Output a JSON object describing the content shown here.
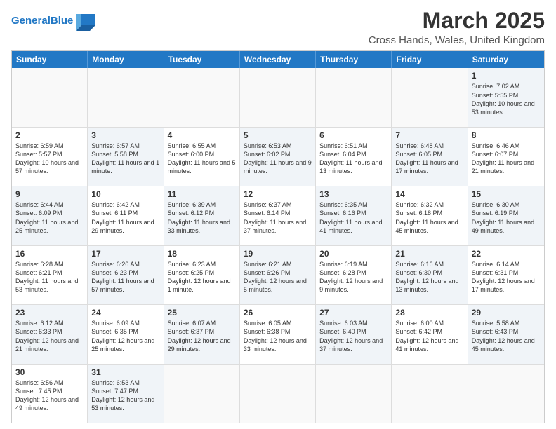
{
  "header": {
    "logo_general": "General",
    "logo_blue": "Blue",
    "month_title": "March 2025",
    "location": "Cross Hands, Wales, United Kingdom"
  },
  "day_headers": [
    "Sunday",
    "Monday",
    "Tuesday",
    "Wednesday",
    "Thursday",
    "Friday",
    "Saturday"
  ],
  "weeks": [
    [
      {
        "day": "",
        "text": "",
        "empty": true
      },
      {
        "day": "",
        "text": "",
        "empty": true
      },
      {
        "day": "",
        "text": "",
        "empty": true
      },
      {
        "day": "",
        "text": "",
        "empty": true
      },
      {
        "day": "",
        "text": "",
        "empty": true
      },
      {
        "day": "",
        "text": "",
        "empty": true
      },
      {
        "day": "1",
        "text": "Sunrise: 7:02 AM\nSunset: 5:55 PM\nDaylight: 10 hours\nand 53 minutes.",
        "shaded": true
      }
    ],
    [
      {
        "day": "2",
        "text": "Sunrise: 6:59 AM\nSunset: 5:57 PM\nDaylight: 10 hours\nand 57 minutes."
      },
      {
        "day": "3",
        "text": "Sunrise: 6:57 AM\nSunset: 5:58 PM\nDaylight: 11 hours\nand 1 minute.",
        "shaded": true
      },
      {
        "day": "4",
        "text": "Sunrise: 6:55 AM\nSunset: 6:00 PM\nDaylight: 11 hours\nand 5 minutes."
      },
      {
        "day": "5",
        "text": "Sunrise: 6:53 AM\nSunset: 6:02 PM\nDaylight: 11 hours\nand 9 minutes.",
        "shaded": true
      },
      {
        "day": "6",
        "text": "Sunrise: 6:51 AM\nSunset: 6:04 PM\nDaylight: 11 hours\nand 13 minutes."
      },
      {
        "day": "7",
        "text": "Sunrise: 6:48 AM\nSunset: 6:05 PM\nDaylight: 11 hours\nand 17 minutes.",
        "shaded": true
      },
      {
        "day": "8",
        "text": "Sunrise: 6:46 AM\nSunset: 6:07 PM\nDaylight: 11 hours\nand 21 minutes."
      }
    ],
    [
      {
        "day": "9",
        "text": "Sunrise: 6:44 AM\nSunset: 6:09 PM\nDaylight: 11 hours\nand 25 minutes.",
        "shaded": true
      },
      {
        "day": "10",
        "text": "Sunrise: 6:42 AM\nSunset: 6:11 PM\nDaylight: 11 hours\nand 29 minutes."
      },
      {
        "day": "11",
        "text": "Sunrise: 6:39 AM\nSunset: 6:12 PM\nDaylight: 11 hours\nand 33 minutes.",
        "shaded": true
      },
      {
        "day": "12",
        "text": "Sunrise: 6:37 AM\nSunset: 6:14 PM\nDaylight: 11 hours\nand 37 minutes."
      },
      {
        "day": "13",
        "text": "Sunrise: 6:35 AM\nSunset: 6:16 PM\nDaylight: 11 hours\nand 41 minutes.",
        "shaded": true
      },
      {
        "day": "14",
        "text": "Sunrise: 6:32 AM\nSunset: 6:18 PM\nDaylight: 11 hours\nand 45 minutes."
      },
      {
        "day": "15",
        "text": "Sunrise: 6:30 AM\nSunset: 6:19 PM\nDaylight: 11 hours\nand 49 minutes.",
        "shaded": true
      }
    ],
    [
      {
        "day": "16",
        "text": "Sunrise: 6:28 AM\nSunset: 6:21 PM\nDaylight: 11 hours\nand 53 minutes."
      },
      {
        "day": "17",
        "text": "Sunrise: 6:26 AM\nSunset: 6:23 PM\nDaylight: 11 hours\nand 57 minutes.",
        "shaded": true
      },
      {
        "day": "18",
        "text": "Sunrise: 6:23 AM\nSunset: 6:25 PM\nDaylight: 12 hours\nand 1 minute."
      },
      {
        "day": "19",
        "text": "Sunrise: 6:21 AM\nSunset: 6:26 PM\nDaylight: 12 hours\nand 5 minutes.",
        "shaded": true
      },
      {
        "day": "20",
        "text": "Sunrise: 6:19 AM\nSunset: 6:28 PM\nDaylight: 12 hours\nand 9 minutes."
      },
      {
        "day": "21",
        "text": "Sunrise: 6:16 AM\nSunset: 6:30 PM\nDaylight: 12 hours\nand 13 minutes.",
        "shaded": true
      },
      {
        "day": "22",
        "text": "Sunrise: 6:14 AM\nSunset: 6:31 PM\nDaylight: 12 hours\nand 17 minutes."
      }
    ],
    [
      {
        "day": "23",
        "text": "Sunrise: 6:12 AM\nSunset: 6:33 PM\nDaylight: 12 hours\nand 21 minutes.",
        "shaded": true
      },
      {
        "day": "24",
        "text": "Sunrise: 6:09 AM\nSunset: 6:35 PM\nDaylight: 12 hours\nand 25 minutes."
      },
      {
        "day": "25",
        "text": "Sunrise: 6:07 AM\nSunset: 6:37 PM\nDaylight: 12 hours\nand 29 minutes.",
        "shaded": true
      },
      {
        "day": "26",
        "text": "Sunrise: 6:05 AM\nSunset: 6:38 PM\nDaylight: 12 hours\nand 33 minutes."
      },
      {
        "day": "27",
        "text": "Sunrise: 6:03 AM\nSunset: 6:40 PM\nDaylight: 12 hours\nand 37 minutes.",
        "shaded": true
      },
      {
        "day": "28",
        "text": "Sunrise: 6:00 AM\nSunset: 6:42 PM\nDaylight: 12 hours\nand 41 minutes."
      },
      {
        "day": "29",
        "text": "Sunrise: 5:58 AM\nSunset: 6:43 PM\nDaylight: 12 hours\nand 45 minutes.",
        "shaded": true
      }
    ],
    [
      {
        "day": "30",
        "text": "Sunrise: 6:56 AM\nSunset: 7:45 PM\nDaylight: 12 hours\nand 49 minutes."
      },
      {
        "day": "31",
        "text": "Sunrise: 6:53 AM\nSunset: 7:47 PM\nDaylight: 12 hours\nand 53 minutes.",
        "shaded": true
      },
      {
        "day": "",
        "text": "",
        "empty": true
      },
      {
        "day": "",
        "text": "",
        "empty": true
      },
      {
        "day": "",
        "text": "",
        "empty": true
      },
      {
        "day": "",
        "text": "",
        "empty": true
      },
      {
        "day": "",
        "text": "",
        "empty": true
      }
    ]
  ]
}
